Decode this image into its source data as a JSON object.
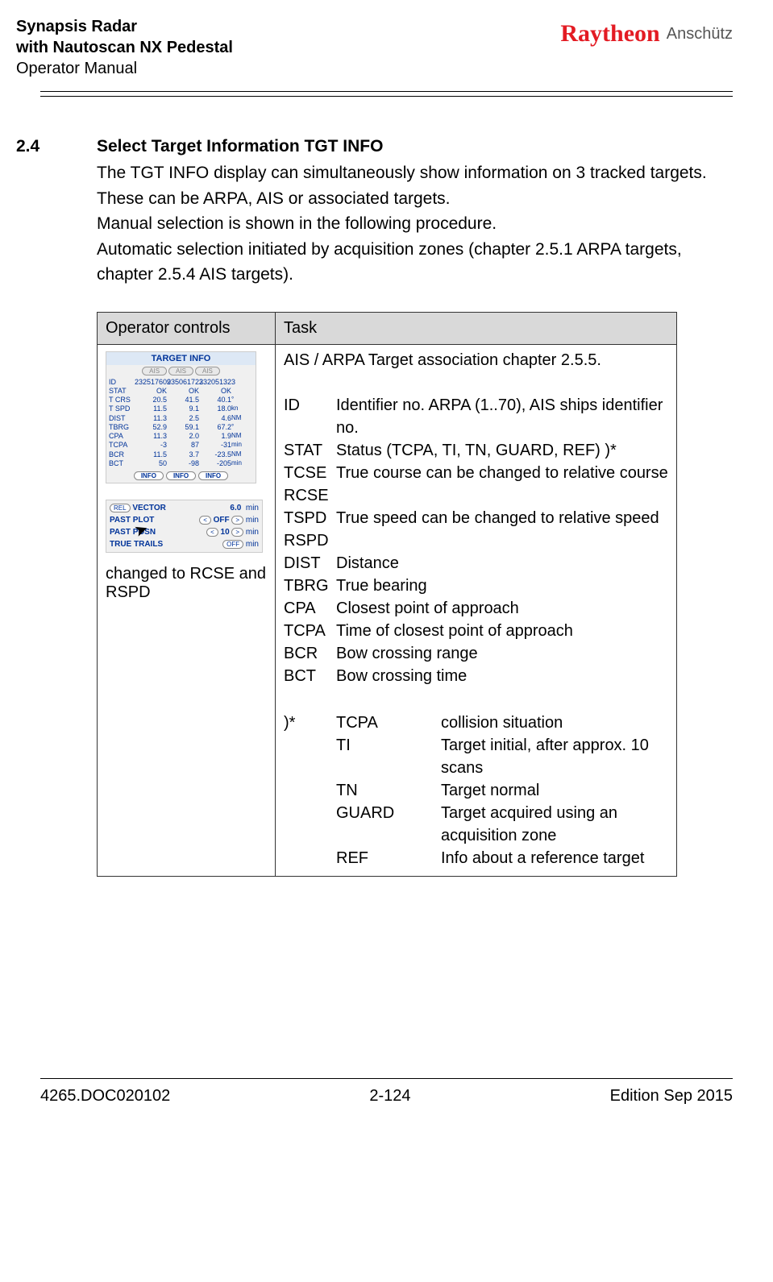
{
  "header": {
    "title_line1": "Synapsis Radar",
    "title_line2": "with Nautoscan NX Pedestal",
    "title_line3": "Operator Manual",
    "brand1": "Raytheon",
    "brand2": "Anschütz"
  },
  "section": {
    "num": "2.4",
    "title": "Select Target Information TGT INFO",
    "body_p1": "The TGT INFO display can simultaneously show information on 3 tracked targets. These can be ARPA, AIS or associated targets.",
    "body_p2": "Manual selection is shown in the following procedure.",
    "body_p3": "Automatic selection initiated by acquisition zones (chapter 2.5.1 ARPA targets, chapter 2.5.4 AIS targets)."
  },
  "table": {
    "col1": "Operator controls",
    "col2": "Task",
    "controls_caption": "changed to RCSE and RSPD",
    "task_intro": "AIS / ARPA Target association chapter 2.5.5.",
    "defs": [
      {
        "k": "ID",
        "v": "Identifier no. ARPA (1..70), AIS ships identifier no."
      },
      {
        "k": "STAT",
        "v": "Status (TCPA, TI, TN, GUARD, REF) )*"
      },
      {
        "k": "TCSE RCSE",
        "v": "True course can be changed to relative course"
      },
      {
        "k": "TSPD RSPD",
        "v": "True speed can be changed to relative speed"
      },
      {
        "k": "DIST",
        "v": "Distance"
      },
      {
        "k": "TBRG",
        "v": "True bearing"
      },
      {
        "k": "CPA",
        "v": "Closest point of approach"
      },
      {
        "k": "TCPA",
        "v": "Time of closest point of approach"
      },
      {
        "k": "BCR",
        "v": "Bow crossing range"
      },
      {
        "k": "BCT",
        "v": "Bow crossing time"
      }
    ],
    "notemark": ")*",
    "statuses": [
      {
        "c": "TCPA",
        "d": "collision situation"
      },
      {
        "c": "TI",
        "d": "Target initial, after approx. 10 scans"
      },
      {
        "c": "TN",
        "d": "Target normal"
      },
      {
        "c": "GUARD",
        "d": "Target acquired using an acquisition zone"
      },
      {
        "c": "REF",
        "d": "Info about a reference target"
      }
    ]
  },
  "target_info_widget": {
    "title": "TARGET INFO",
    "tabs": [
      "AIS",
      "AIS",
      "AIS"
    ],
    "rows": [
      [
        "ID",
        "232517609",
        "235061723",
        "232051323",
        ""
      ],
      [
        "STAT",
        "OK",
        "OK",
        "OK",
        ""
      ],
      [
        "T CRS",
        "20.5",
        "41.5",
        "40.1",
        "°"
      ],
      [
        "T SPD",
        "11.5",
        "9.1",
        "18.0",
        "kn"
      ],
      [
        "DIST",
        "11.3",
        "2.5",
        "4.6",
        "NM"
      ],
      [
        "TBRG",
        "52.9",
        "59.1",
        "67.2",
        "°"
      ],
      [
        "CPA",
        "11.3",
        "2.0",
        "1.9",
        "NM"
      ],
      [
        "TCPA",
        "-3",
        "87",
        "-31",
        "min"
      ],
      [
        "BCR",
        "11.5",
        "3.7",
        "-23.5",
        "NM"
      ],
      [
        "BCT",
        "50",
        "-98",
        "-205",
        "min"
      ]
    ],
    "info_btn": "INFO"
  },
  "vector_widget": {
    "row1_label": "VECTOR",
    "row1_btn": "REL",
    "row1_val": "6.0",
    "row1_unit": "min",
    "row2_label": "PAST PLOT",
    "row2_btn": "OFF",
    "row2_unit": "min",
    "row3_label": "PAST POSN",
    "row3_val": "10",
    "row3_unit": "min",
    "row4_label": "TRUE TRAILS",
    "row4_btn": "OFF",
    "row4_unit": "min",
    "arrow_l": "<",
    "arrow_r": ">"
  },
  "footer": {
    "left": "4265.DOC020102",
    "center": "2-124",
    "right": "Edition Sep 2015"
  }
}
